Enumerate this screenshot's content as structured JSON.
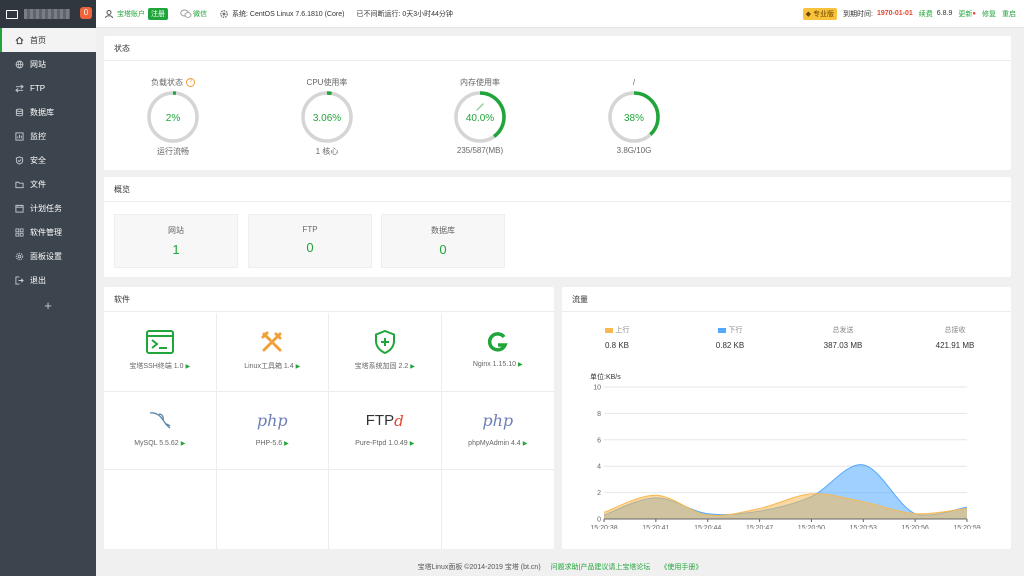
{
  "sidebar": {
    "badge": "0",
    "items": [
      {
        "label": "首页",
        "icon": "home-icon"
      },
      {
        "label": "网站",
        "icon": "globe-icon"
      },
      {
        "label": "FTP",
        "icon": "ftp-icon"
      },
      {
        "label": "数据库",
        "icon": "database-icon"
      },
      {
        "label": "监控",
        "icon": "monitor-icon"
      },
      {
        "label": "安全",
        "icon": "shield-icon"
      },
      {
        "label": "文件",
        "icon": "folder-icon"
      },
      {
        "label": "计划任务",
        "icon": "clock-icon"
      },
      {
        "label": "软件管理",
        "icon": "apps-icon"
      },
      {
        "label": "面板设置",
        "icon": "gear-icon"
      },
      {
        "label": "退出",
        "icon": "logout-icon"
      }
    ],
    "plus": "+"
  },
  "topbar": {
    "account": "宝塔账户",
    "register": "注册",
    "wechat": "微信",
    "system": "系统:  CentOS Linux 7.6.1810 (Core)",
    "uptime": "已不间断运行: 0天3小时44分钟",
    "pro": "专业版",
    "expire_label": "到期时间:",
    "expire_date": "1970-01-01",
    "renew": "续费",
    "version": "6.8.9",
    "update": "更新",
    "fix": "修复",
    "restart": "重启"
  },
  "status": {
    "title": "状态",
    "gauges": [
      {
        "label": "负载状态",
        "value": "2%",
        "sub": "运行流畅",
        "percent": 2,
        "help": "?"
      },
      {
        "label": "CPU使用率",
        "value": "3.06%",
        "sub": "1 核心",
        "percent": 3.06
      },
      {
        "label": "内存使用率",
        "value": "40.0%",
        "sub": "235/587(MB)",
        "percent": 40
      },
      {
        "label": "/",
        "value": "38%",
        "sub": "3.8G/10G",
        "percent": 38
      }
    ]
  },
  "overview": {
    "title": "概览",
    "items": [
      {
        "label": "网站",
        "value": "1"
      },
      {
        "label": "FTP",
        "value": "0"
      },
      {
        "label": "数据库",
        "value": "0"
      }
    ]
  },
  "software": {
    "title": "软件",
    "items": [
      {
        "name": "宝塔SSH终端 1.0",
        "icon": "terminal-icon"
      },
      {
        "name": "Linux工具箱 1.4",
        "icon": "tools-icon"
      },
      {
        "name": "宝塔系统加固 2.2",
        "icon": "shield-plus-icon"
      },
      {
        "name": "Nginx 1.15.10",
        "icon": "nginx-icon"
      },
      {
        "name": "MySQL 5.5.62",
        "icon": "mysql-icon"
      },
      {
        "name": "PHP-5.6",
        "icon": "php-icon",
        "glyph": "php"
      },
      {
        "name": "Pure-Ftpd 1.0.49",
        "icon": "ftp-logo-icon",
        "glyph": "FTP",
        "glyph2": "d"
      },
      {
        "name": "phpMyAdmin 4.4",
        "icon": "php-icon",
        "glyph": "php"
      }
    ],
    "arrow": "▶"
  },
  "traffic": {
    "title": "流量",
    "stats": [
      {
        "label": "上行",
        "value": "0.8 KB",
        "color": "#f7b851"
      },
      {
        "label": "下行",
        "value": "0.82 KB",
        "color": "#52a9ff"
      },
      {
        "label": "总发送",
        "value": "387.03 MB"
      },
      {
        "label": "总接收",
        "value": "421.91 MB"
      }
    ]
  },
  "chart_data": {
    "type": "area",
    "ylabel": "单位:KB/s",
    "ylim": [
      0,
      10
    ],
    "yticks": [
      "0",
      "2",
      "4",
      "6",
      "8",
      "10"
    ],
    "x": [
      "15:20:38",
      "15:20:41",
      "15:20:44",
      "15:20:47",
      "15:20:50",
      "15:20:53",
      "15:20:56",
      "15:20:59"
    ],
    "series": [
      {
        "name": "上行",
        "color": "#f7b851",
        "values": [
          0.5,
          1.8,
          0.3,
          0.8,
          1.9,
          1.3,
          0.4,
          0.8
        ]
      },
      {
        "name": "下行",
        "color": "#52a9ff",
        "values": [
          0.3,
          1.6,
          0.4,
          0.6,
          1.7,
          4.1,
          0.4,
          0.9
        ]
      }
    ],
    "grid": true,
    "legend": "none"
  },
  "footer": {
    "copyright": "宝塔Linux面板 ©2014-2019 宝塔 (bt.cn)",
    "forum": "问题求助|产品建议请上宝塔论坛",
    "manual": "《使用手册》"
  },
  "colors": {
    "accent": "#20a53a",
    "sidebar": "#3c444d"
  }
}
